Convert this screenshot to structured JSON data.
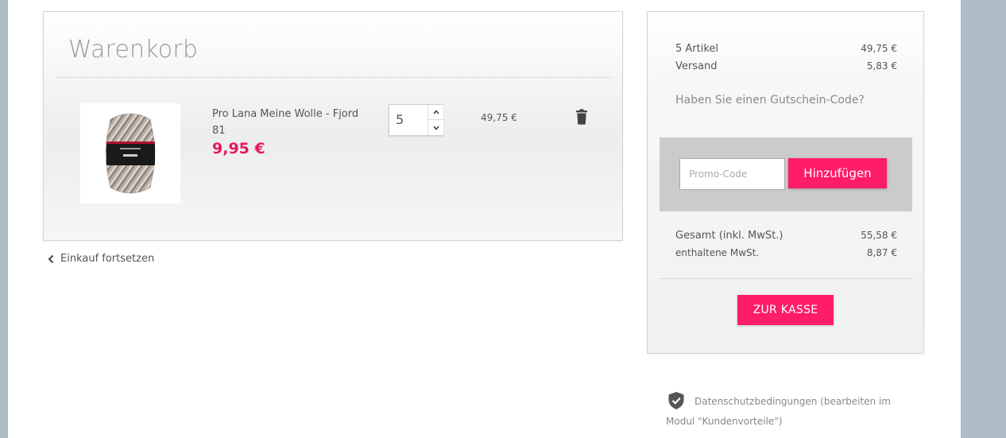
{
  "cart": {
    "title": "Warenkorb",
    "item": {
      "image_alt": "Pro Lana Meine Wolle Fjord yarn ball",
      "name": "Pro Lana Meine Wolle - Fjord 81",
      "unit_price": "9,95 €",
      "quantity": "5",
      "line_total": "49,75 €"
    },
    "continue_label": "Einkauf fortsetzen"
  },
  "summary": {
    "items_label": "5 Artikel",
    "items_value": "49,75 €",
    "shipping_label": "Versand",
    "shipping_value": "5,83 €",
    "voucher_question": "Haben Sie einen Gutschein-Code?",
    "promo_placeholder": "Promo-Code",
    "promo_button": "Hinzufügen",
    "total_label": "Gesamt (inkl. MwSt.)",
    "total_value": "55,58 €",
    "tax_label": "enthaltene MwSt.",
    "tax_value": "8,87 €",
    "checkout_button": "ZUR KASSE"
  },
  "privacy": {
    "text": "Datenschutzbedingungen (bearbeiten im Modul \"Kundenvorteile\")"
  },
  "colors": {
    "accent": "#ff1c68",
    "price": "#e5195c",
    "background": "#aebcc5"
  },
  "icons": [
    "trash-icon",
    "chevron-left-icon",
    "chevron-up-icon",
    "chevron-down-icon",
    "shield-check-icon"
  ]
}
